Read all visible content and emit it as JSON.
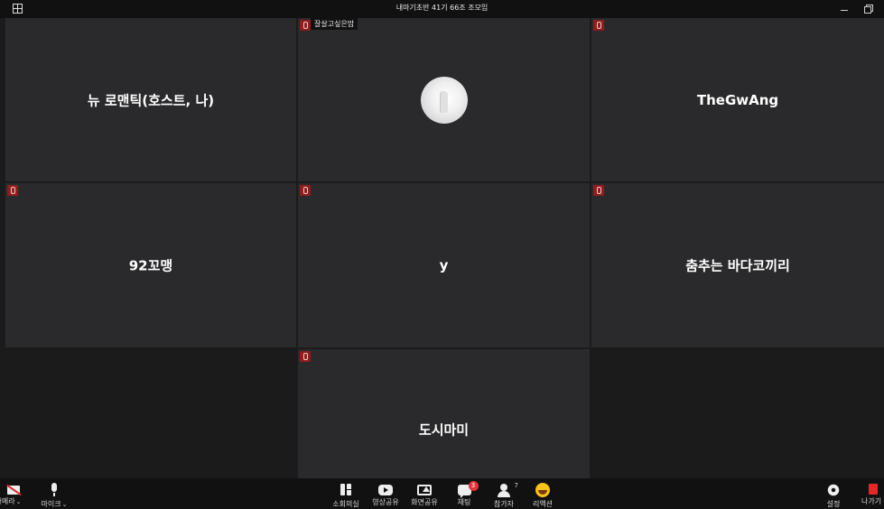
{
  "window": {
    "title": "내마기초반 41기 66조 조모임"
  },
  "participants": [
    {
      "name": "뉴 로맨틱(호스트, 나)",
      "muted": true,
      "show_name": true
    },
    {
      "name": "잘살고싶은맘",
      "muted": true,
      "show_name": false,
      "avatar": "photo-avatar"
    },
    {
      "name": "TheGwAng",
      "muted": true,
      "show_name": true
    },
    {
      "name": "92꼬맹",
      "muted": true,
      "show_name": true
    },
    {
      "name": "y",
      "muted": true,
      "show_name": true
    },
    {
      "name": "춤추는 바다코끼리",
      "muted": true,
      "show_name": true
    },
    {
      "name": "도시마미",
      "muted": true,
      "show_name": true
    }
  ],
  "toolbar": {
    "camera_label": "카메라",
    "mic_label": "마이크",
    "breakout_label": "소회의실",
    "video_share_label": "영상공유",
    "screen_share_label": "화면공유",
    "chat_label": "채팅",
    "chat_badge": "3",
    "participants_label": "참가자",
    "participants_count": "7",
    "reactions_label": "리액션",
    "settings_label": "설정",
    "leave_label": "나가기"
  },
  "colors": {
    "tile_bg": "#2a2a2c",
    "mute_badge": "#8f1d1d",
    "chat_badge": "#e0343a",
    "leave": "#e02a2a"
  }
}
